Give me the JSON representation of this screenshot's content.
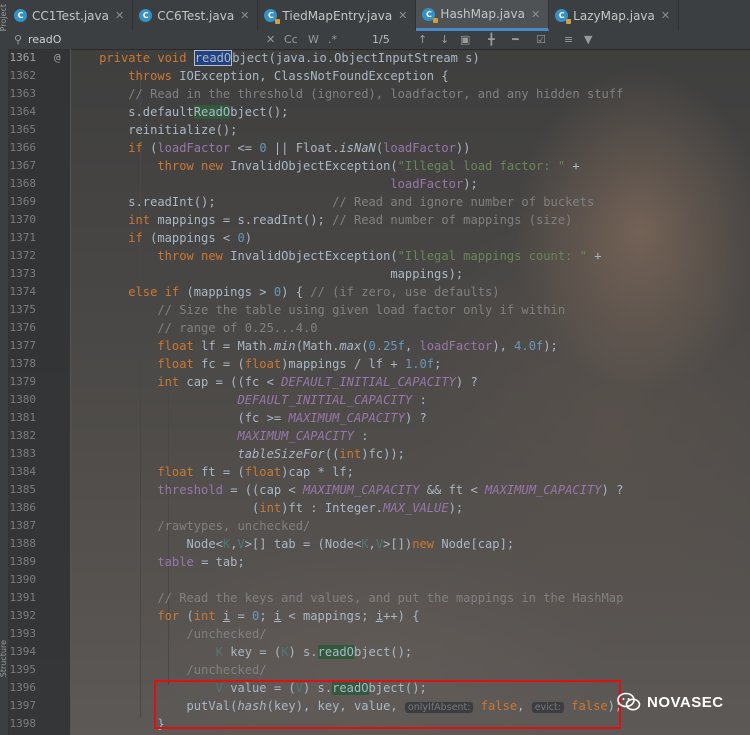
{
  "tabs": [
    {
      "label": "CC1Test.java",
      "locked": false
    },
    {
      "label": "CC6Test.java",
      "locked": false
    },
    {
      "label": "TiedMapEntry.java",
      "locked": true
    },
    {
      "label": "HashMap.java",
      "locked": true,
      "active": true
    },
    {
      "label": "LazyMap.java",
      "locked": true
    }
  ],
  "find": {
    "query": "readO",
    "case_label": "Cc",
    "words_label": "W",
    "regex_label": ".*",
    "match_count": "1/5"
  },
  "sidebar": {
    "label": "Project",
    "bottom_label": "Structure"
  },
  "lines": [
    "1361",
    "1362",
    "1363",
    "1364",
    "1365",
    "1366",
    "1367",
    "1368",
    "1369",
    "1370",
    "1371",
    "1372",
    "1373",
    "1374",
    "1375",
    "1376",
    "1377",
    "1378",
    "1379",
    "1380",
    "1381",
    "1382",
    "1383",
    "1384",
    "1385",
    "1386",
    "1387",
    "1388",
    "1389",
    "1390",
    "1391",
    "1392",
    "1393",
    "1394",
    "1395",
    "1396",
    "1397",
    "1398"
  ],
  "gutter_mark": "@",
  "hints": {
    "only_if_absent": "onlyIfAbsent:",
    "evict": "evict:"
  },
  "watermark": {
    "text": "NOVASEC"
  },
  "colors": {
    "keyword": "#cc7832",
    "comment": "#808080",
    "number": "#6897bb",
    "string": "#6a8759",
    "constant": "#9876aa",
    "highlight": "#e01010"
  }
}
